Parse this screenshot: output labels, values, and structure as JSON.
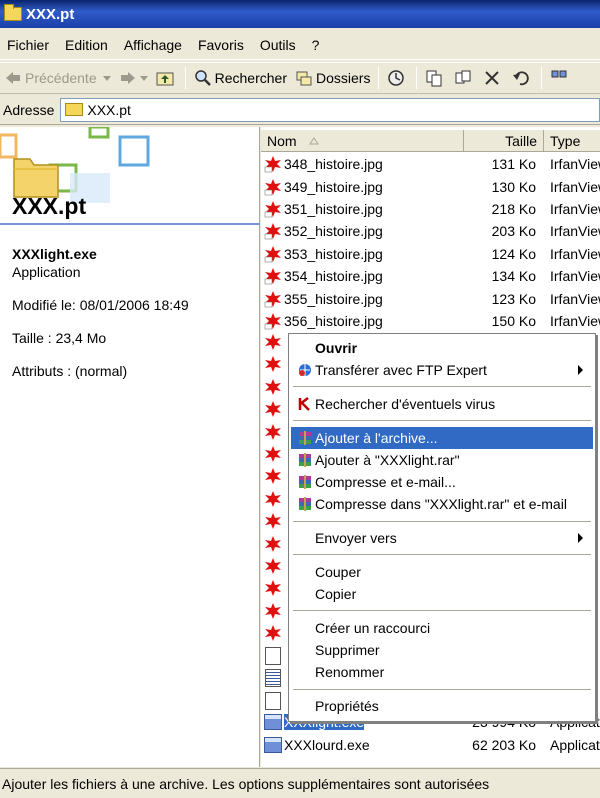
{
  "window": {
    "title": "XXX.pt"
  },
  "menubar": [
    "Fichier",
    "Edition",
    "Affichage",
    "Favoris",
    "Outils",
    "?"
  ],
  "toolbar": {
    "back_label": "Précédente",
    "search_label": "Rechercher",
    "folders_label": "Dossiers"
  },
  "address": {
    "label": "Adresse",
    "value": "XXX.pt"
  },
  "left_pane": {
    "folder_title": "XXX.pt",
    "file_name": "XXXlight.exe",
    "file_type": "Application",
    "modified": "Modifié le: 08/01/2006 18:49",
    "size": "Taille : 23,4 Mo",
    "attributes": "Attributs : (normal)"
  },
  "columns": {
    "name": "Nom",
    "size": "Taille",
    "type": "Type"
  },
  "files": [
    {
      "name": "348_histoire.jpg",
      "size": "131 Ko",
      "type": "IrfanView",
      "icon": "irfanview-jpg-icon"
    },
    {
      "name": "349_histoire.jpg",
      "size": "130 Ko",
      "type": "IrfanView",
      "icon": "irfanview-jpg-icon"
    },
    {
      "name": "351_histoire.jpg",
      "size": "218 Ko",
      "type": "IrfanView",
      "icon": "irfanview-jpg-icon"
    },
    {
      "name": "352_histoire.jpg",
      "size": "203 Ko",
      "type": "IrfanView",
      "icon": "irfanview-jpg-icon"
    },
    {
      "name": "353_histoire.jpg",
      "size": "124 Ko",
      "type": "IrfanView",
      "icon": "irfanview-jpg-icon"
    },
    {
      "name": "354_histoire.jpg",
      "size": "134 Ko",
      "type": "IrfanView",
      "icon": "irfanview-jpg-icon"
    },
    {
      "name": "355_histoire.jpg",
      "size": "123 Ko",
      "type": "IrfanView",
      "icon": "irfanview-jpg-icon"
    },
    {
      "name": "356_histoire.jpg",
      "size": "150 Ko",
      "type": "IrfanView",
      "icon": "irfanview-jpg-icon"
    }
  ],
  "bottom_files": [
    {
      "name": "XXXlight.exe",
      "size": "23 994 Ko",
      "type": "Applicat",
      "selected": true
    },
    {
      "name": "XXXlourd.exe",
      "size": "62 203 Ko",
      "type": "Applicat",
      "selected": false
    }
  ],
  "context_menu": {
    "open": "Ouvrir",
    "ftp": "Transférer avec FTP Expert",
    "virus": "Rechercher d'éventuels virus",
    "add_archive": "Ajouter à l'archive...",
    "add_rar": "Ajouter à \"XXXlight.rar\"",
    "compress_email": "Compresse et e-mail...",
    "compress_rar_email": "Compresse dans \"XXXlight.rar\" et e-mail",
    "send_to": "Envoyer vers",
    "cut": "Couper",
    "copy": "Copier",
    "shortcut": "Créer un raccourci",
    "delete": "Supprimer",
    "rename": "Renommer",
    "properties": "Propriétés"
  },
  "status": "Ajouter les fichiers à une archive. Les options supplémentaires sont autorisées"
}
